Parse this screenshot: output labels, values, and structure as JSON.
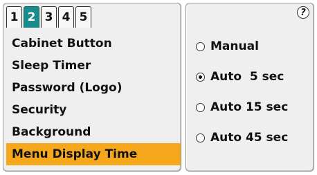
{
  "tabs": [
    {
      "label": "1",
      "active": false
    },
    {
      "label": "2",
      "active": true
    },
    {
      "label": "3",
      "active": false
    },
    {
      "label": "4",
      "active": false
    },
    {
      "label": "5",
      "active": false
    }
  ],
  "menu": {
    "items": [
      {
        "label": "Cabinet Button",
        "selected": false
      },
      {
        "label": "Sleep Timer",
        "selected": false
      },
      {
        "label": "Password (Logo)",
        "selected": false
      },
      {
        "label": "Security",
        "selected": false
      },
      {
        "label": "Background",
        "selected": false
      },
      {
        "label": "Menu Display Time",
        "selected": true
      }
    ]
  },
  "help": {
    "icon": "help-icon",
    "glyph": "?"
  },
  "options": [
    {
      "label": "Manual",
      "checked": false
    },
    {
      "label": "Auto  5 sec",
      "checked": true
    },
    {
      "label": "Auto 15 sec",
      "checked": false
    },
    {
      "label": "Auto 45 sec",
      "checked": false
    }
  ],
  "colors": {
    "active_tab": "#1a8c8c",
    "selection": "#f6a81c",
    "panel": "#efefef"
  }
}
